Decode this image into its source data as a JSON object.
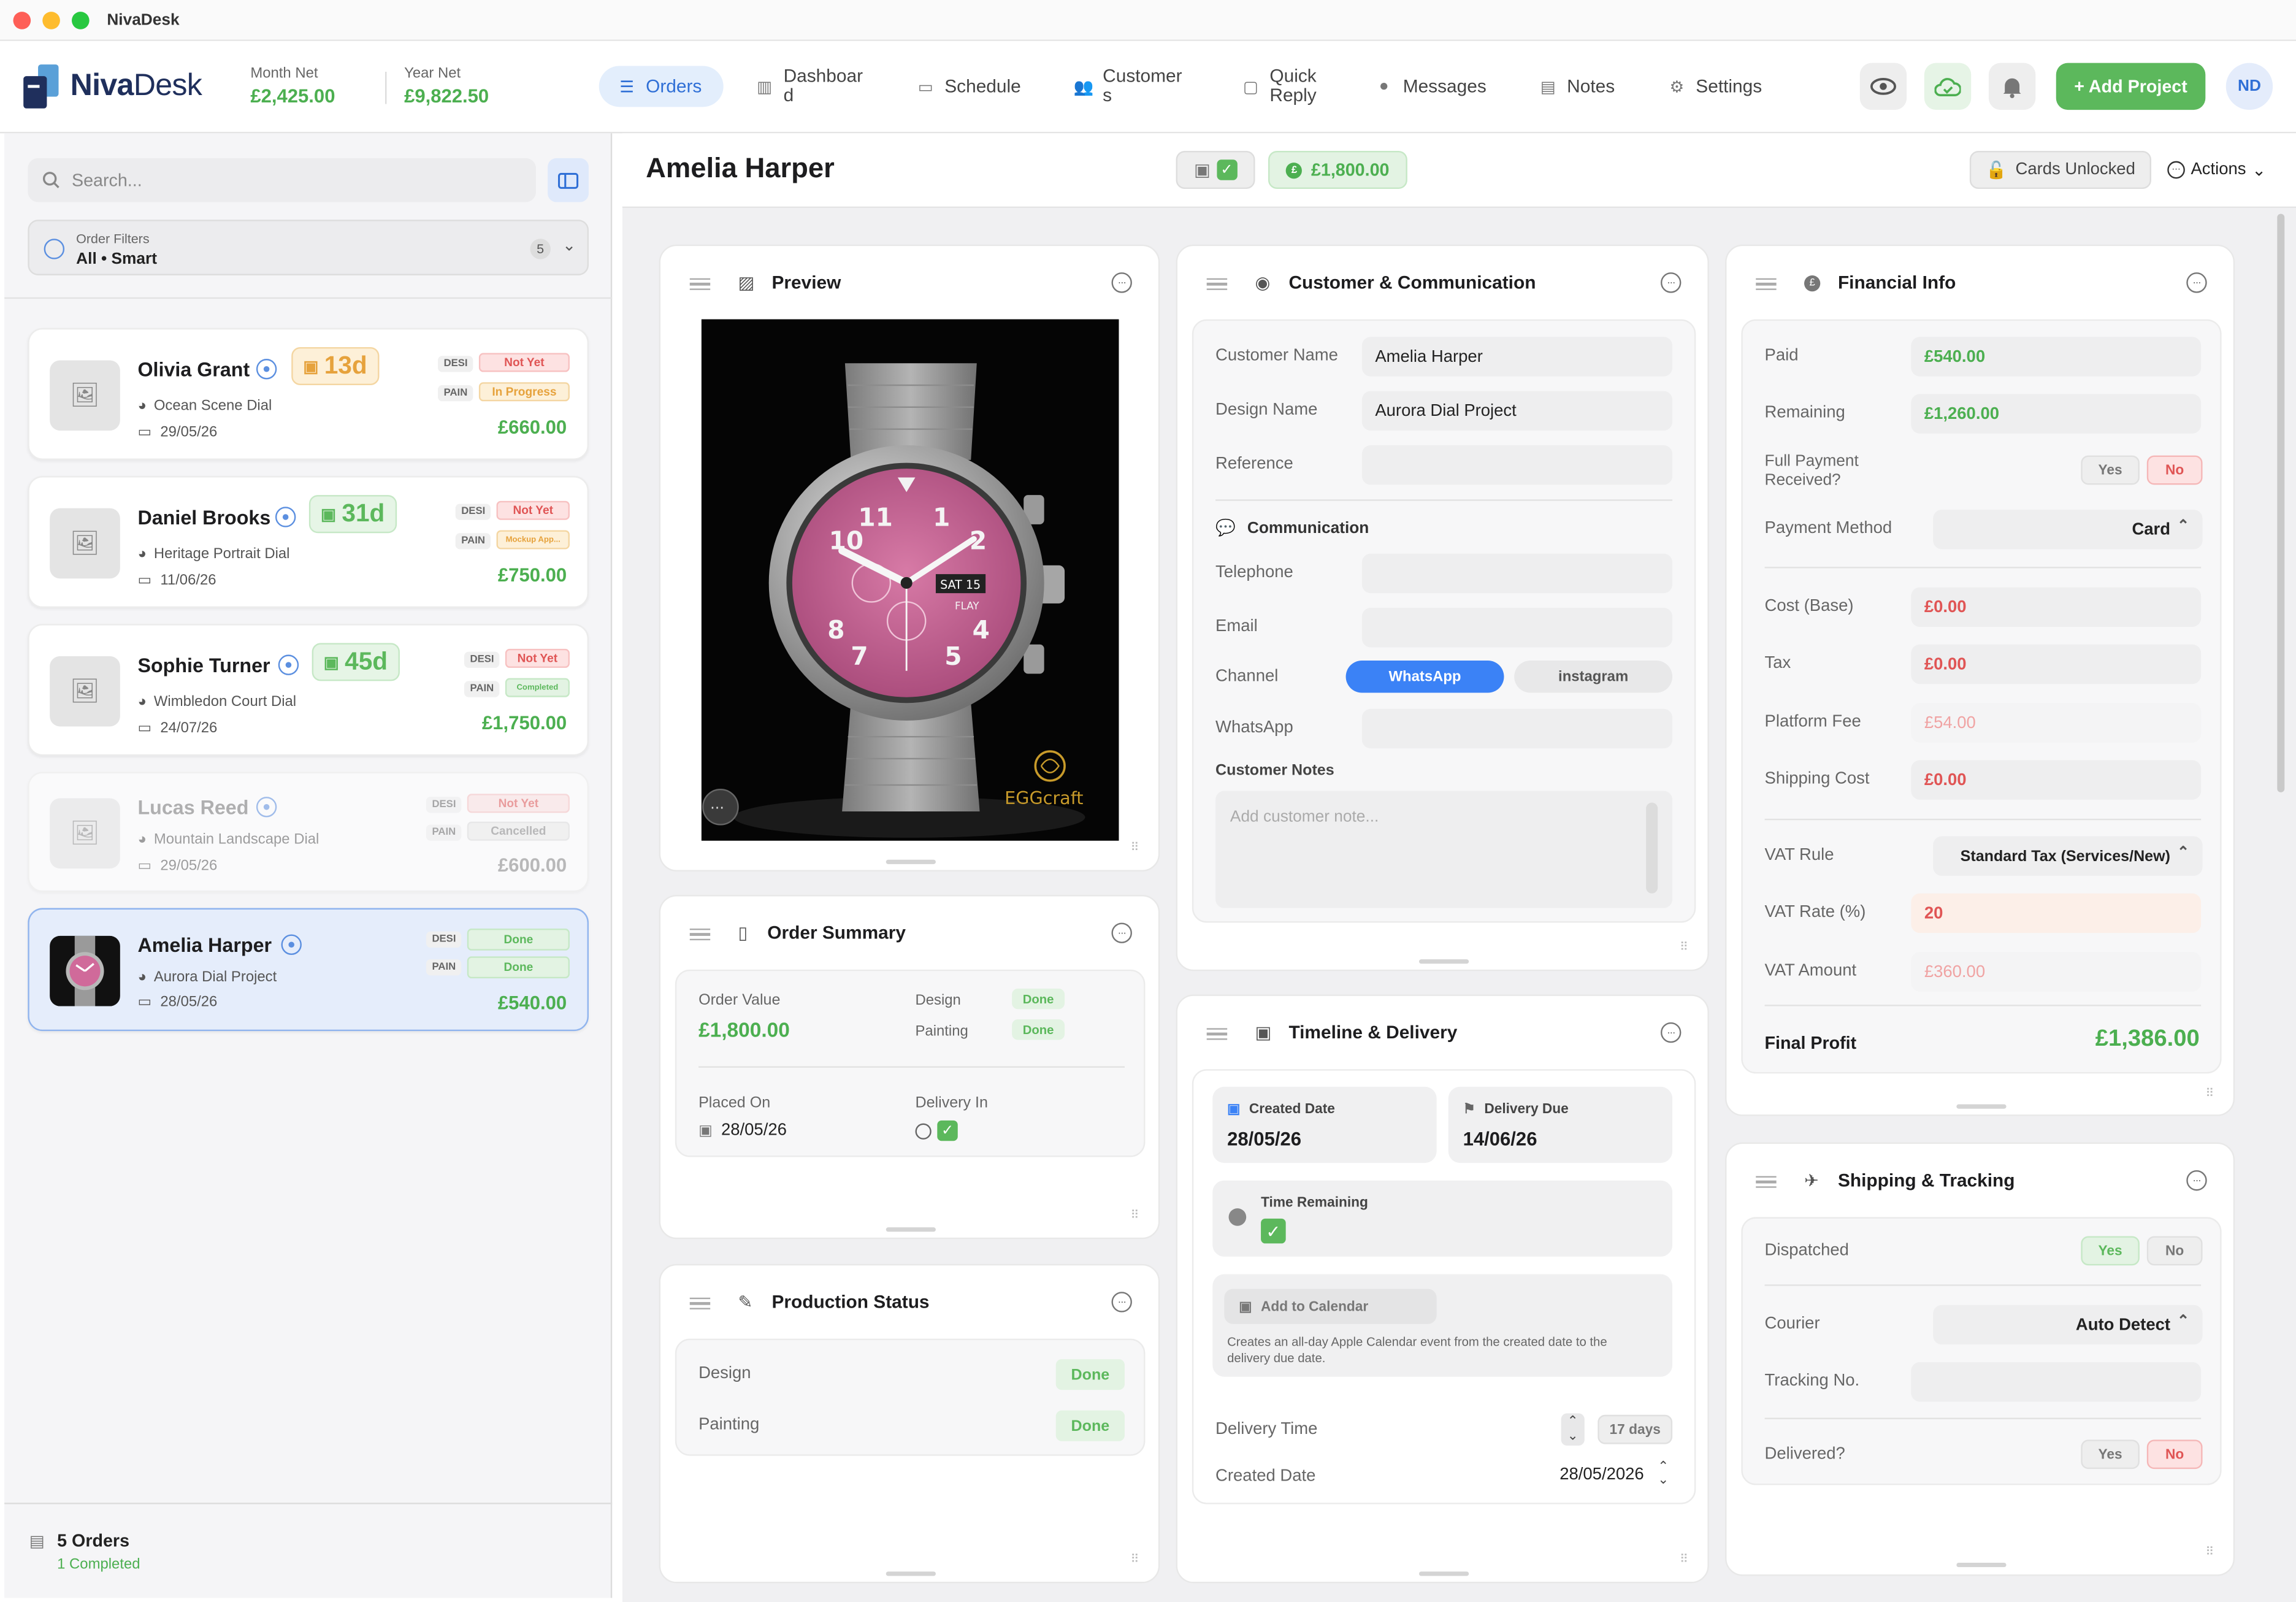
{
  "window": {
    "title": "NivaDesk"
  },
  "brand": {
    "name_bold": "Niva",
    "name_rest": "Desk"
  },
  "stats": {
    "month_label": "Month Net",
    "month_value": "£2,425.00",
    "year_label": "Year Net",
    "year_value": "£9,822.50"
  },
  "nav": {
    "orders": "Orders",
    "dashboard_1": "Dashboar",
    "dashboard_2": "d",
    "schedule": "Schedule",
    "customers_1": "Customer",
    "customers_2": "s",
    "quick_1": "Quick",
    "quick_2": "Reply",
    "messages": "Messages",
    "notes": "Notes",
    "settings": "Settings"
  },
  "topright": {
    "add_project": "+ Add Project",
    "avatar": "ND"
  },
  "sidebar": {
    "search_placeholder": "Search...",
    "filter_label": "Order Filters",
    "filter_value": "All • Smart",
    "filter_count": "5",
    "orders": [
      {
        "name": "Olivia Grant",
        "days": "13d",
        "design": "Ocean Scene Dial",
        "date": "29/05/26",
        "desi": "DESI",
        "desi_status": "Not Yet",
        "pain": "PAIN",
        "pain_status": "In Progress",
        "price": "£660.00"
      },
      {
        "name": "Daniel Brooks",
        "days": "31d",
        "design": "Heritage Portrait Dial",
        "date": "11/06/26",
        "desi": "DESI",
        "desi_status": "Not Yet",
        "pain": "PAIN",
        "pain_status": "Mockup App...",
        "price": "£750.00"
      },
      {
        "name": "Sophie Turner",
        "days": "45d",
        "design": "Wimbledon Court Dial",
        "date": "24/07/26",
        "desi": "DESI",
        "desi_status": "Not Yet",
        "pain": "PAIN",
        "pain_status": "Completed",
        "price": "£1,750.00"
      },
      {
        "name": "Lucas Reed",
        "design": "Mountain Landscape Dial",
        "date": "29/05/26",
        "desi": "DESI",
        "desi_status": "Not Yet",
        "pain": "PAIN",
        "pain_status": "Cancelled",
        "price": "£600.00"
      },
      {
        "name": "Amelia Harper",
        "design": "Aurora Dial Project",
        "date": "28/05/26",
        "desi": "DESI",
        "desi_status": "Done",
        "pain": "PAIN",
        "pain_status": "Done",
        "price": "£540.00"
      }
    ],
    "footer_count": "5 Orders",
    "footer_completed": "1 Completed"
  },
  "main": {
    "title": "Amelia Harper",
    "amount_badge": "£1,800.00",
    "cards_unlocked": "Cards Unlocked",
    "actions": "Actions"
  },
  "preview": {
    "title": "Preview",
    "watermark": "EGGcraft",
    "day_window": "SAT 15",
    "brand_text": "FLAY"
  },
  "summary": {
    "title": "Order Summary",
    "order_value_label": "Order Value",
    "order_value": "£1,800.00",
    "design_label": "Design",
    "design_status": "Done",
    "painting_label": "Painting",
    "painting_status": "Done",
    "placed_label": "Placed On",
    "placed_value": "28/05/26",
    "delivery_label": "Delivery In"
  },
  "production": {
    "title": "Production Status",
    "design_label": "Design",
    "design_status": "Done",
    "painting_label": "Painting",
    "painting_status": "Done"
  },
  "customer": {
    "title": "Customer & Communication",
    "name_label": "Customer Name",
    "name_value": "Amelia Harper",
    "design_label": "Design Name",
    "design_value": "Aurora Dial Project",
    "ref_label": "Reference",
    "comm_title": "Communication",
    "tel_label": "Telephone",
    "email_label": "Email",
    "channel_label": "Channel",
    "channel_active": "WhatsApp",
    "channel_other": "instagram",
    "whatsapp_label": "WhatsApp",
    "notes_label": "Customer Notes",
    "notes_placeholder": "Add customer note..."
  },
  "timeline": {
    "title": "Timeline & Delivery",
    "created_label": "Created Date",
    "created_value": "28/05/26",
    "due_label": "Delivery Due",
    "due_value": "14/06/26",
    "remaining_label": "Time Remaining",
    "calendar_btn": "Add to Calendar",
    "calendar_desc": "Creates an all-day Apple Calendar event from the created date to the delivery due date.",
    "delivery_time_label": "Delivery Time",
    "delivery_time_value": "17 days",
    "created_date_label": "Created Date",
    "created_date_value": "28/05/2026"
  },
  "financial": {
    "title": "Financial Info",
    "paid_label": "Paid",
    "paid_value": "£540.00",
    "remaining_label": "Remaining",
    "remaining_value": "£1,260.00",
    "full_label_1": "Full Payment",
    "full_label_2": "Received?",
    "yes": "Yes",
    "no": "No",
    "method_label": "Payment Method",
    "method_value": "Card",
    "cost_label": "Cost (Base)",
    "cost_value": "£0.00",
    "tax_label": "Tax",
    "tax_value": "£0.00",
    "platform_label": "Platform Fee",
    "platform_value": "£54.00",
    "shipping_label": "Shipping Cost",
    "shipping_value": "£0.00",
    "vat_rule_label": "VAT Rule",
    "vat_rule_value": "Standard Tax (Services/New)",
    "vat_rate_label": "VAT Rate (%)",
    "vat_rate_value": "20",
    "vat_amount_label": "VAT Amount",
    "vat_amount_value": "£360.00",
    "profit_label": "Final Profit",
    "profit_value": "£1,386.00"
  },
  "shipping": {
    "title": "Shipping & Tracking",
    "dispatched_label": "Dispatched",
    "yes": "Yes",
    "no": "No",
    "courier_label": "Courier",
    "courier_value": "Auto Detect",
    "tracking_label": "Tracking No.",
    "delivered_label": "Delivered?"
  },
  "colors": {
    "accent": "#2f6fd6",
    "success": "#4caf50",
    "danger": "#e05555",
    "warning": "#e6a23c"
  }
}
